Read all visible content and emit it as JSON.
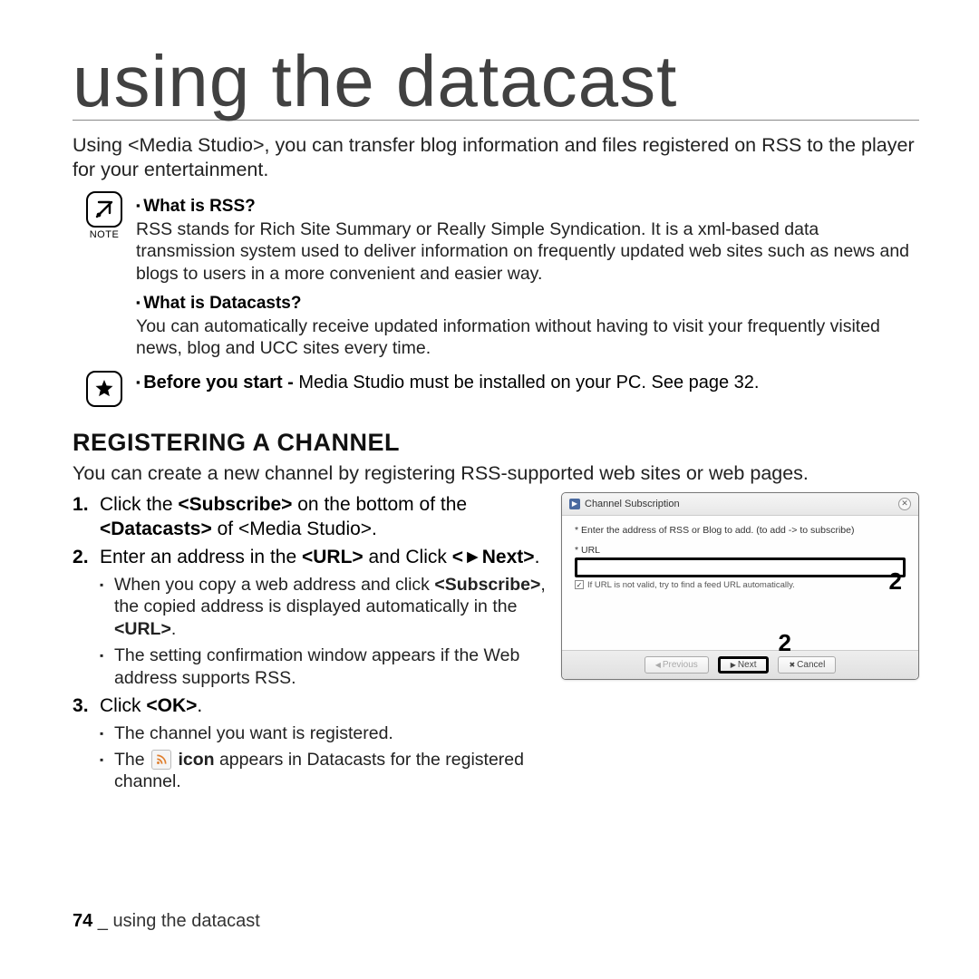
{
  "title": "using the datacast",
  "intro": "Using <Media Studio>, you can transfer blog information and files registered on RSS to the player for your entertainment.",
  "note_caption": "NOTE",
  "note": {
    "q1": "What is RSS?",
    "a1": "RSS stands for Rich Site Summary or Really Simple Syndication. It is a xml-based data transmission system used to deliver information on frequently updated web sites such as news and blogs to users in a more convenient and easier way.",
    "q2": "What is Datacasts?",
    "a2": "You can automatically receive updated information without having to visit your frequently visited news, blog and UCC sites every time."
  },
  "star": {
    "lead": "Before you start - ",
    "rest": "Media Studio must be installed on your PC. See page 32."
  },
  "section_h": "REGISTERING A CHANNEL",
  "section_intro": "You can create a new channel by registering RSS-supported web sites or web pages.",
  "steps": {
    "s1_a": "Click the ",
    "s1_b": "<Subscribe>",
    "s1_c": " on the bottom of the ",
    "s1_d": "<Datacasts>",
    "s1_e": " of <Media Studio>.",
    "s2_a": "Enter an address in the ",
    "s2_b": "<URL>",
    "s2_c": " and Click ",
    "s2_d": "<►Next>",
    "s2_e": ".",
    "s2_sub1_a": "When you copy a web address and click ",
    "s2_sub1_b": "<Subscribe>",
    "s2_sub1_c": ", the copied address is displayed automatically in the ",
    "s2_sub1_d": "<URL>",
    "s2_sub1_e": ".",
    "s2_sub2": "The setting confirmation window appears if the Web address supports RSS.",
    "s3_a": "Click ",
    "s3_b": "<OK>",
    "s3_c": ".",
    "s3_sub1": "The channel you want is registered.",
    "s3_sub2_a": "The ",
    "s3_sub2_b": " icon",
    "s3_sub2_c": " appears in Datacasts for the registered channel."
  },
  "dialog": {
    "title": "Channel Subscription",
    "hint": "* Enter the address of RSS or Blog to add. (to add -> to subscribe)",
    "url_label": "* URL",
    "chk_label": "If URL is not valid, try to find a feed URL automatically.",
    "prev": "Previous",
    "next": "Next",
    "cancel": "Cancel",
    "callout": "2"
  },
  "footer": {
    "page": "74",
    "sep": " _ ",
    "name": "using the datacast"
  }
}
